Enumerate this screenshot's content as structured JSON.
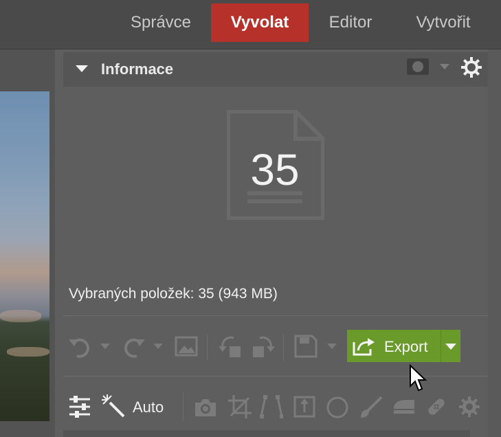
{
  "nav": {
    "tabs": [
      {
        "label": "Správce"
      },
      {
        "label": "Vyvolat",
        "active": true
      },
      {
        "label": "Editor"
      },
      {
        "label": "Vytvořit"
      }
    ],
    "active_color": "#b53129"
  },
  "panel": {
    "title": "Informace",
    "count": "35",
    "selected_info": "Vybraných položek: 35 (943 MB)"
  },
  "toolbar": {
    "export_label": "Export",
    "export_color": "#6a9a2a",
    "auto_label": "Auto"
  },
  "icons": [
    "undo-icon",
    "redo-icon",
    "image-icon",
    "rotate-left-icon",
    "rotate-right-icon",
    "save-icon",
    "export-icon",
    "adjustments-icon",
    "magic-wand-icon",
    "camera-icon",
    "crop-icon",
    "perspective-icon",
    "straighten-icon",
    "circle-icon",
    "brush-icon",
    "eraser-icon",
    "bandage-icon",
    "gear-icon"
  ]
}
